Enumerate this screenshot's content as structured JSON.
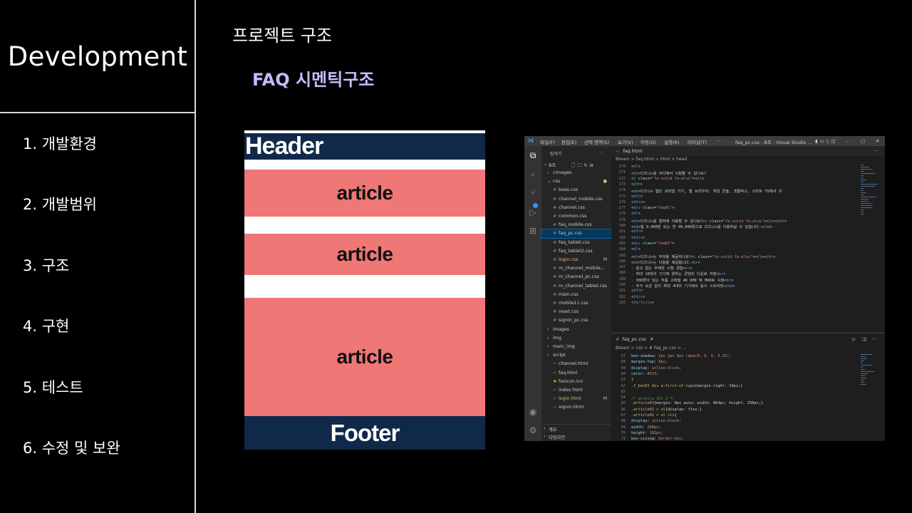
{
  "sidebar": {
    "brand": "Development",
    "items": [
      {
        "label": "1. 개발환경"
      },
      {
        "label": "2. 개발범위"
      },
      {
        "label": "3. 구조"
      },
      {
        "label": "4. 구현"
      },
      {
        "label": "5. 테스트"
      },
      {
        "label": "6. 수정 및 보완"
      }
    ]
  },
  "main": {
    "title": "프로젝트 구조",
    "section_title": "FAQ 시멘틱구조"
  },
  "diagram": {
    "header": "Header",
    "article1": "article",
    "article2": "article",
    "article3": "article",
    "footer": "Footer",
    "colors": {
      "header": "#10284a",
      "article": "#ef7775",
      "footer": "#10284a"
    }
  },
  "vscode": {
    "menus": [
      "파일(F)",
      "편집(E)",
      "선택 영역(S)",
      "보기(V)",
      "이동(G)",
      "실행(R)",
      "터미널(T)",
      "···"
    ],
    "window_title": "faq_pc.css - B조 - Visual Studio ...",
    "explorer_title": "탐색기",
    "explorer_more": "···",
    "root": "B조",
    "tree": [
      {
        "label": "cimages",
        "kind": "folder-closed"
      },
      {
        "label": "css",
        "kind": "folder-open",
        "mark": "●"
      },
      {
        "label": "base.css",
        "kind": "css"
      },
      {
        "label": "channel_mobile.css",
        "kind": "css"
      },
      {
        "label": "channel.css",
        "kind": "css"
      },
      {
        "label": "common.css",
        "kind": "css"
      },
      {
        "label": "faq_mobile.css",
        "kind": "css"
      },
      {
        "label": "faq_pc.css",
        "kind": "css",
        "selected": true
      },
      {
        "label": "faq_tablet.css",
        "kind": "css"
      },
      {
        "label": "faq_tablet2.css",
        "kind": "css"
      },
      {
        "label": "login.css",
        "kind": "css",
        "mark": "M"
      },
      {
        "label": "m_channel_mobile...",
        "kind": "css"
      },
      {
        "label": "m_channel_pc.css",
        "kind": "css"
      },
      {
        "label": "m_channel_tablet.css",
        "kind": "css"
      },
      {
        "label": "main.css",
        "kind": "css"
      },
      {
        "label": "mobile11.css",
        "kind": "css"
      },
      {
        "label": "reset.css",
        "kind": "css"
      },
      {
        "label": "signin_pc.css",
        "kind": "css"
      },
      {
        "label": "images",
        "kind": "folder-closed"
      },
      {
        "label": "img",
        "kind": "folder-closed"
      },
      {
        "label": "main_img",
        "kind": "folder-closed"
      },
      {
        "label": "script",
        "kind": "folder-closed"
      },
      {
        "label": "channel.html",
        "kind": "html"
      },
      {
        "label": "faq.html",
        "kind": "html"
      },
      {
        "label": "favicon.ico",
        "kind": "star"
      },
      {
        "label": "index.html",
        "kind": "html"
      },
      {
        "label": "login.html",
        "kind": "html",
        "mark": "M"
      },
      {
        "label": "signin.html",
        "kind": "html"
      }
    ],
    "outline": "개요",
    "timeline": "타임라인",
    "tab_top": "faq.html",
    "crumb_top": "Bteam > faq.html > html > head",
    "tab_bottom": "faq_pc.css",
    "crumb_bottom": "Bteam > css > # faq_pc.css > ...",
    "code_top": [
      {
        "n": "170",
        "t": "        <dl>"
      },
      {
        "n": "171",
        "t": "          <dt>디즈니+를 어디에서 시청할 수 있나요?"
      },
      {
        "n": "172",
        "t": "            <i class=\"fa-solid fa-plus\"></i>"
      },
      {
        "n": "173",
        "t": "          </dt>"
      },
      {
        "n": "174",
        "t": "          <dd>디즈니+ 웹은 모바일 기기, 웹 브라우저, 게임 콘솔, 셋톱박스, 스마트 TV에서 이"
      },
      {
        "n": "175",
        "t": "        </dl>"
      },
      {
        "n": "176",
        "t": "      </div>"
      },
      {
        "n": "177",
        "t": "      <div class=\"faq01\">"
      },
      {
        "n": "178",
        "t": "        <dl>"
      },
      {
        "n": "179",
        "t": "          <dt>디즈니+를 얼마에 이용할 수 있나요?<i class=\"fa-solid fa-plus\"></i></dt>"
      },
      {
        "n": "180",
        "t": "          <dd>월 9,900원 또는 연 99,000원으로 디즈니+를 이용하실 수 있습니다.</dd>"
      },
      {
        "n": "181",
        "t": "        </dl>"
      },
      {
        "n": "182",
        "t": "      </div>"
      },
      {
        "n": "183",
        "t": "      <div class=\"faq01\">"
      },
      {
        "n": "184",
        "t": "        <dl>"
      },
      {
        "n": "185",
        "t": "          <dt>디즈니+는 무엇을 제공하나요?<i class=\"fa-solid fa-plus\"></i></dt>"
      },
      {
        "n": "186",
        "t": "          <dd>디즈니+는 다음을 제공합니다.<br>"
      },
      {
        "n": "187",
        "t": "            - 광고 없는 무제한 시청 경험<br>"
      },
      {
        "n": "188",
        "t": "            - 최대 10대의 기기에 원하는 콘텐츠 다운로 저장<br>"
      },
      {
        "n": "189",
        "t": "            - 300편이 넘는 작품 고화질 4K UHD 및 HDR로 시청<br>"
      },
      {
        "n": "190",
        "t": "            - 추가 요금 없이 최대 4대의 기기에서 동시 스트리밍</dd>"
      },
      {
        "n": "191",
        "t": "        </dl>"
      },
      {
        "n": "192",
        "t": "      </div>"
      },
      {
        "n": "193",
        "t": "    </article>"
      }
    ],
    "code_bottom": [
      {
        "n": "57",
        "t": "    box-shadow: 1px 2px 4px rgba(0, 0, 0, 0.25);"
      },
      {
        "n": "58",
        "t": "    margin-top: 8px;"
      },
      {
        "n": "59",
        "t": "    display: inline-block;"
      },
      {
        "n": "60",
        "t": "    color: #333;"
      },
      {
        "n": "61",
        "t": "}"
      },
      {
        "n": "62",
        "t": ".f_box01 div a:first-of-type{margin-right: 19px;}"
      },
      {
        "n": "63",
        "t": ""
      },
      {
        "n": "64",
        "t": "/* article 코드 2 */"
      },
      {
        "n": "65",
        "t": ".article02{margin: 0px auto; width: 864px; height: 250px;}"
      },
      {
        "n": "66",
        "t": ".article02 > ul{display: flex;}"
      },
      {
        "n": "67",
        "t": ".article02 > ul >li{"
      },
      {
        "n": "68",
        "t": "  display: inline-block;"
      },
      {
        "n": "69",
        "t": "  width: 280px;"
      },
      {
        "n": "70",
        "t": "  height: 182px;"
      },
      {
        "n": "71",
        "t": "  box-sizing: border-box;"
      }
    ]
  }
}
